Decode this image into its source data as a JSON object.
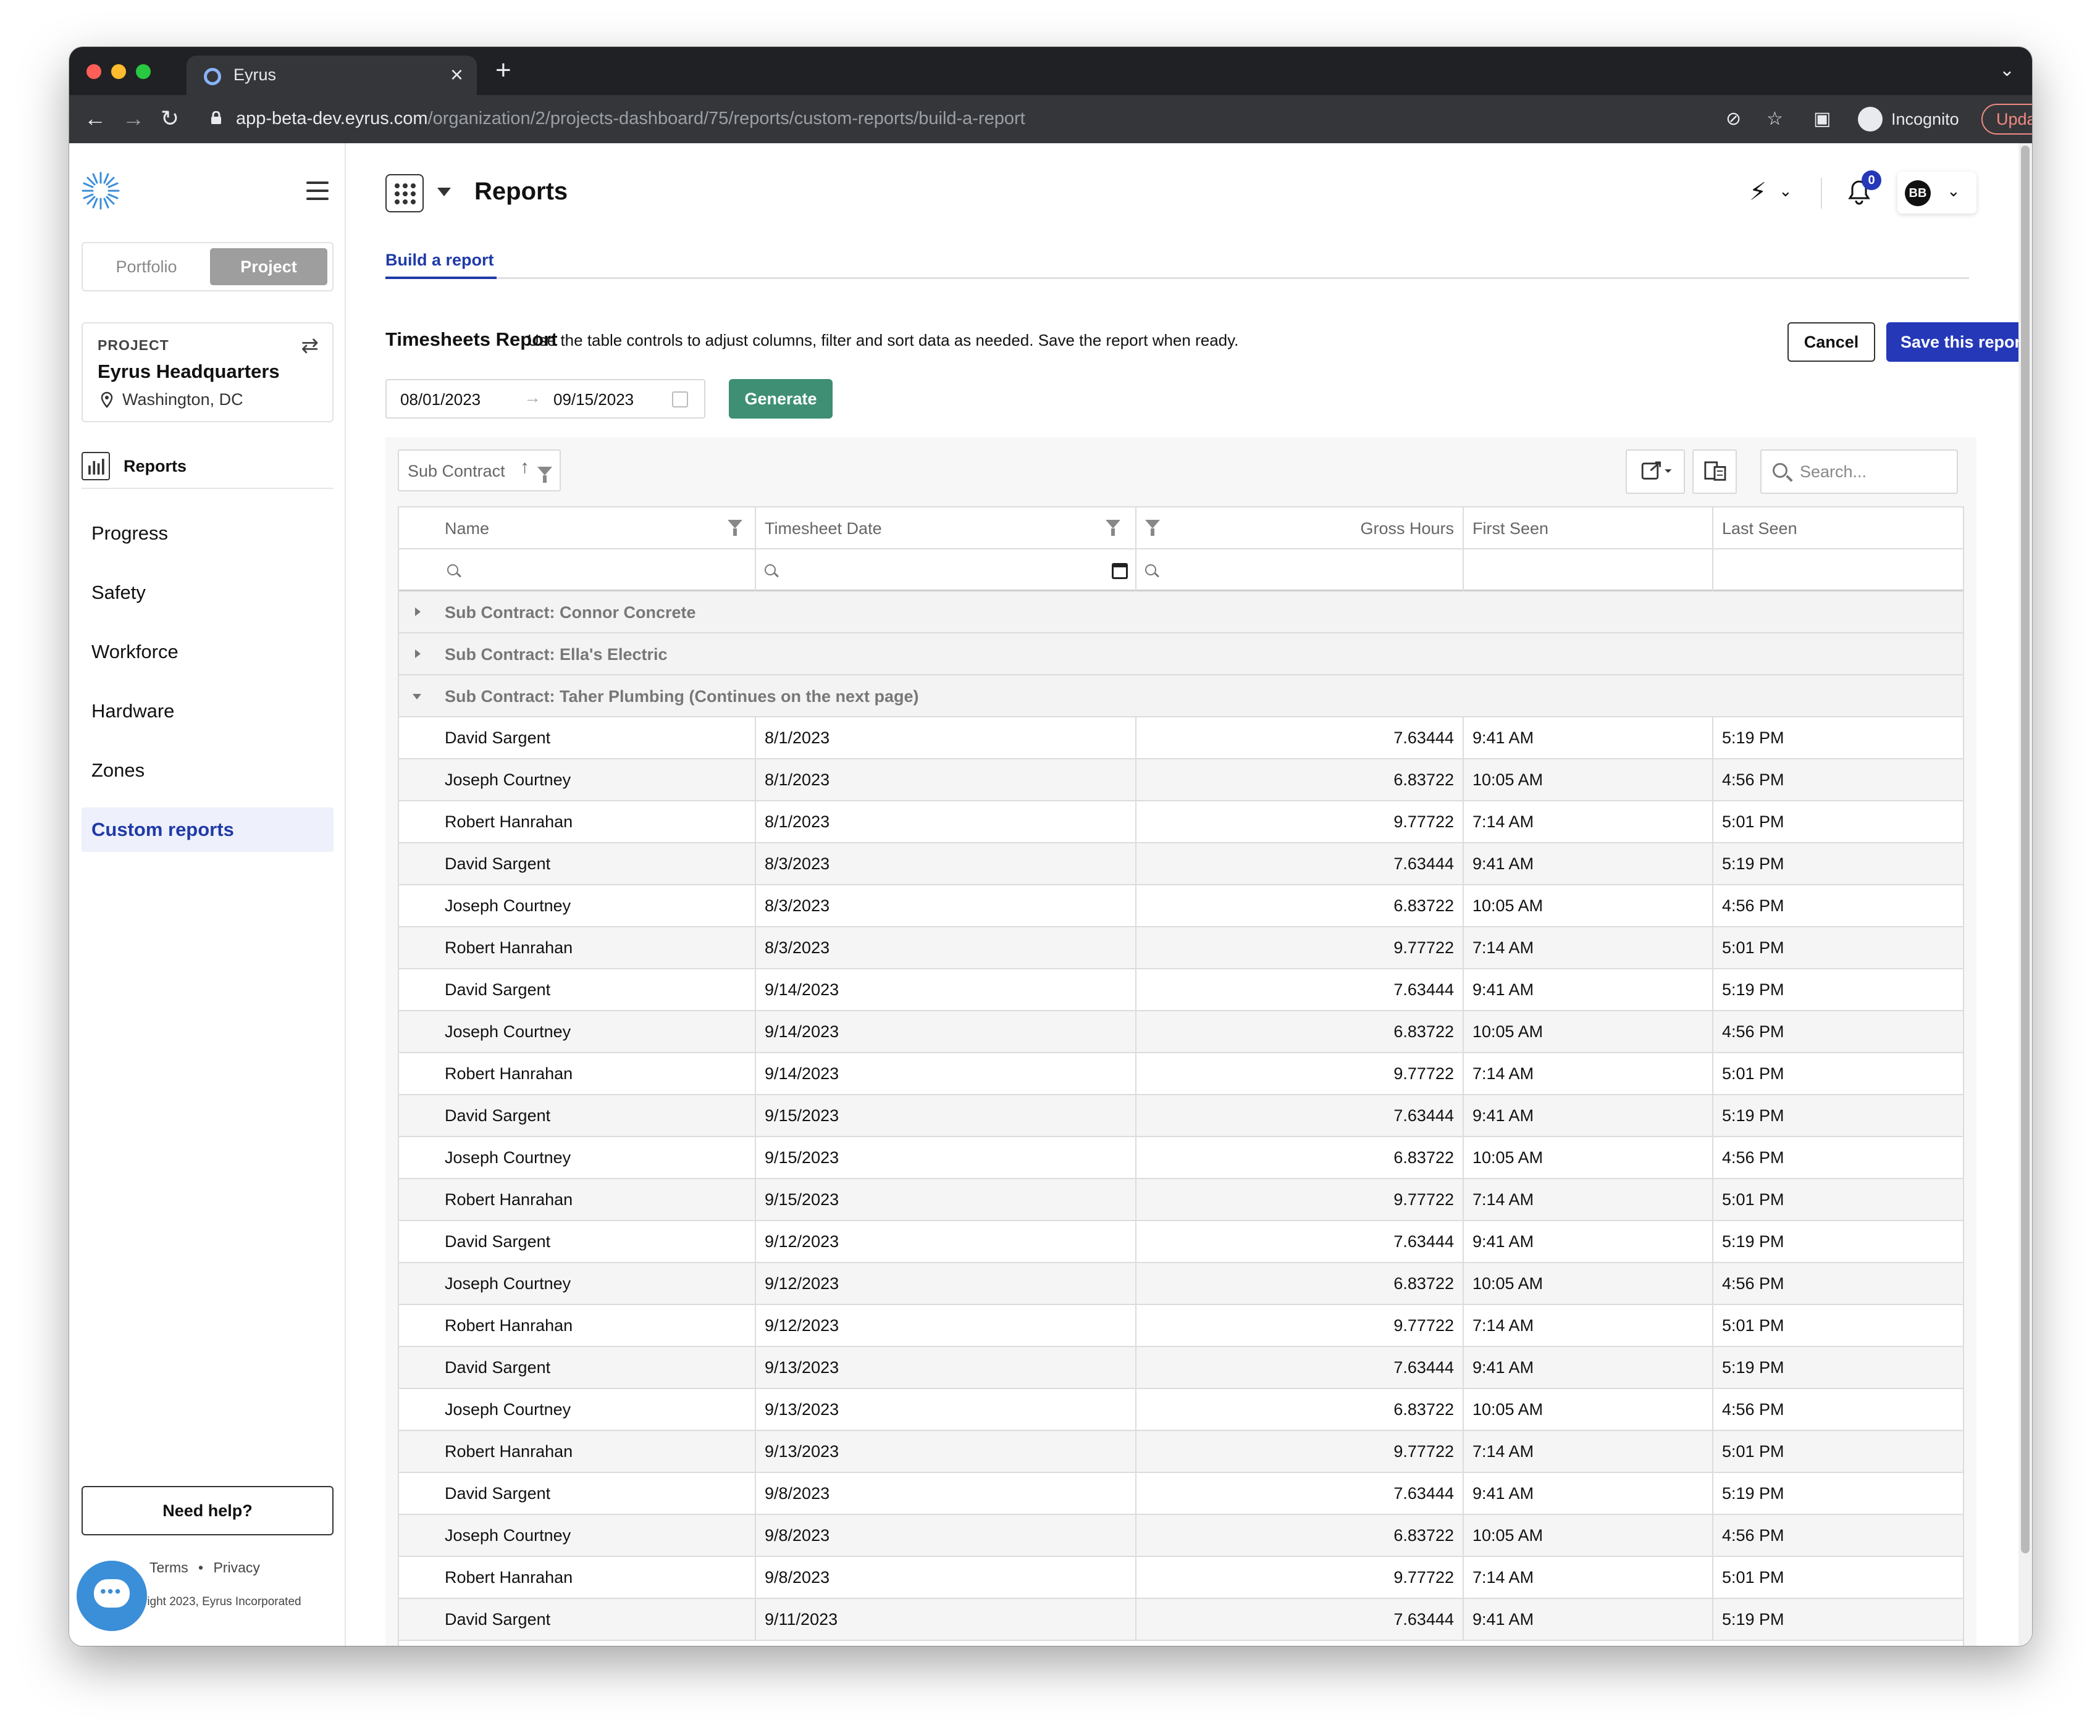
{
  "browser": {
    "tab_title": "Eyrus",
    "url_host": "app-beta-dev.eyrus.com",
    "url_path": "/organization/2/projects-dashboard/75/reports/custom-reports/build-a-report",
    "incognito_label": "Incognito",
    "update_label": "Update"
  },
  "sidebar": {
    "toggle": {
      "portfolio": "Portfolio",
      "project": "Project"
    },
    "project": {
      "label": "PROJECT",
      "name": "Eyrus Headquarters",
      "location": "Washington, DC"
    },
    "section_label": "Reports",
    "nav": [
      "Progress",
      "Safety",
      "Workforce",
      "Hardware",
      "Zones",
      "Custom reports"
    ],
    "active_nav": "Custom reports",
    "help_label": "Need help?",
    "terms": "Terms",
    "separator": "•",
    "privacy": "Privacy",
    "copyright": "right 2023, Eyrus Incorporated"
  },
  "header": {
    "title": "Reports",
    "notification_count": "0",
    "user_initials": "BB"
  },
  "subtab": "Build a report",
  "report": {
    "title": "Timesheets Report",
    "description": "Use the table controls to adjust columns, filter and sort data as needed. Save the report when ready.",
    "cancel_label": "Cancel",
    "save_label": "Save this report",
    "date_start": "08/01/2023",
    "date_end": "09/15/2023",
    "date_arrow": "→",
    "generate_label": "Generate"
  },
  "grid": {
    "group_by": "Sub Contract",
    "search_placeholder": "Search...",
    "columns": [
      "Name",
      "Timesheet Date",
      "Gross Hours",
      "First Seen",
      "Last Seen"
    ],
    "groups": [
      {
        "label": "Sub Contract: Connor Concrete",
        "expanded": false
      },
      {
        "label": "Sub Contract: Ella's Electric",
        "expanded": false
      },
      {
        "label": "Sub Contract: Taher Plumbing (Continues on the next page)",
        "expanded": true
      }
    ],
    "rows": [
      [
        "David Sargent",
        "8/1/2023",
        "7.63444",
        "9:41 AM",
        "5:19 PM"
      ],
      [
        "Joseph Courtney",
        "8/1/2023",
        "6.83722",
        "10:05 AM",
        "4:56 PM"
      ],
      [
        "Robert Hanrahan",
        "8/1/2023",
        "9.77722",
        "7:14 AM",
        "5:01 PM"
      ],
      [
        "David Sargent",
        "8/3/2023",
        "7.63444",
        "9:41 AM",
        "5:19 PM"
      ],
      [
        "Joseph Courtney",
        "8/3/2023",
        "6.83722",
        "10:05 AM",
        "4:56 PM"
      ],
      [
        "Robert Hanrahan",
        "8/3/2023",
        "9.77722",
        "7:14 AM",
        "5:01 PM"
      ],
      [
        "David Sargent",
        "9/14/2023",
        "7.63444",
        "9:41 AM",
        "5:19 PM"
      ],
      [
        "Joseph Courtney",
        "9/14/2023",
        "6.83722",
        "10:05 AM",
        "4:56 PM"
      ],
      [
        "Robert Hanrahan",
        "9/14/2023",
        "9.77722",
        "7:14 AM",
        "5:01 PM"
      ],
      [
        "David Sargent",
        "9/15/2023",
        "7.63444",
        "9:41 AM",
        "5:19 PM"
      ],
      [
        "Joseph Courtney",
        "9/15/2023",
        "6.83722",
        "10:05 AM",
        "4:56 PM"
      ],
      [
        "Robert Hanrahan",
        "9/15/2023",
        "9.77722",
        "7:14 AM",
        "5:01 PM"
      ],
      [
        "David Sargent",
        "9/12/2023",
        "7.63444",
        "9:41 AM",
        "5:19 PM"
      ],
      [
        "Joseph Courtney",
        "9/12/2023",
        "6.83722",
        "10:05 AM",
        "4:56 PM"
      ],
      [
        "Robert Hanrahan",
        "9/12/2023",
        "9.77722",
        "7:14 AM",
        "5:01 PM"
      ],
      [
        "David Sargent",
        "9/13/2023",
        "7.63444",
        "9:41 AM",
        "5:19 PM"
      ],
      [
        "Joseph Courtney",
        "9/13/2023",
        "6.83722",
        "10:05 AM",
        "4:56 PM"
      ],
      [
        "Robert Hanrahan",
        "9/13/2023",
        "9.77722",
        "7:14 AM",
        "5:01 PM"
      ],
      [
        "David Sargent",
        "9/8/2023",
        "7.63444",
        "9:41 AM",
        "5:19 PM"
      ],
      [
        "Joseph Courtney",
        "9/8/2023",
        "6.83722",
        "10:05 AM",
        "4:56 PM"
      ],
      [
        "Robert Hanrahan",
        "9/8/2023",
        "9.77722",
        "7:14 AM",
        "5:01 PM"
      ],
      [
        "David Sargent",
        "9/11/2023",
        "7.63444",
        "9:41 AM",
        "5:19 PM"
      ]
    ]
  },
  "colors": {
    "accent": "#2538b8",
    "generate": "#3e8f74",
    "active_nav_bg": "#eef0fb"
  }
}
